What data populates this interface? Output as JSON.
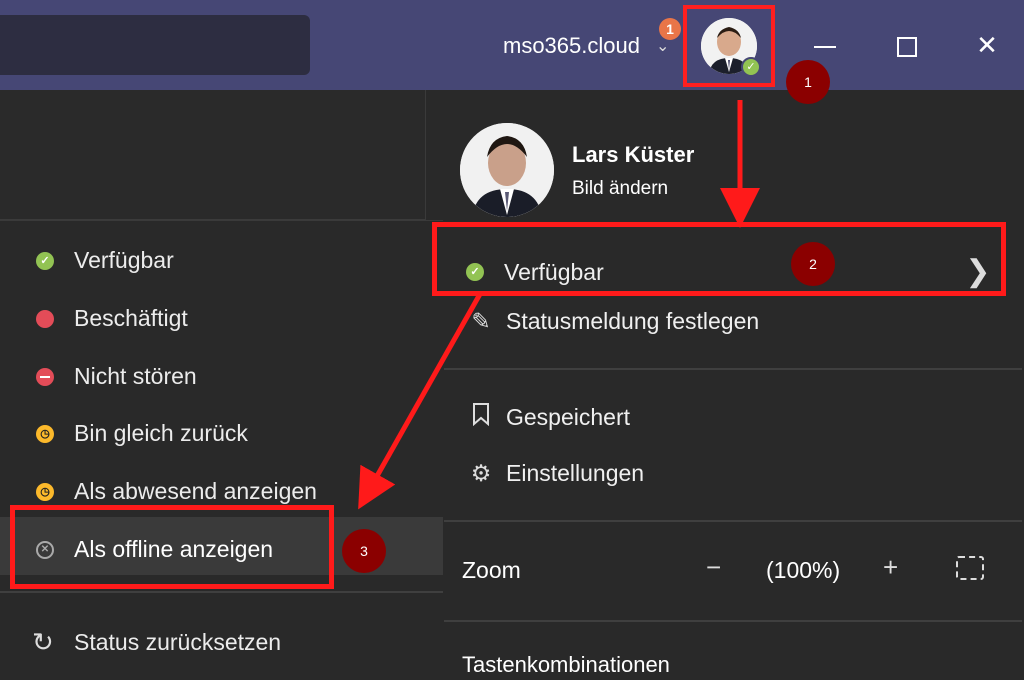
{
  "titlebar": {
    "tenant": "mso365.cloud",
    "notification_count": "1",
    "minimize_icon": "minimize-icon",
    "maximize_icon": "maximize-icon",
    "close_icon": "close-icon",
    "accent": "#464775"
  },
  "profile": {
    "name": "Lars Küster",
    "change_picture": "Bild ändern",
    "status_label": "Verfügbar",
    "status_message": "Statusmeldung festlegen",
    "saved": "Gespeichert",
    "settings": "Einstellungen",
    "zoom_label": "Zoom",
    "zoom_minus": "−",
    "zoom_value": "(100%)",
    "zoom_plus": "+",
    "shortcuts": "Tastenkombinationen"
  },
  "status_menu": {
    "items": [
      {
        "label": "Verfügbar",
        "color": "#92c353"
      },
      {
        "label": "Beschäftigt",
        "color": "#e34c58"
      },
      {
        "label": "Nicht stören",
        "color": "#e34c58"
      },
      {
        "label": "Bin gleich zurück",
        "color": "#fcb92b"
      },
      {
        "label": "Als abwesend anzeigen",
        "color": "#fcb92b"
      },
      {
        "label": "Als offline anzeigen",
        "color": "#aaaaaa"
      }
    ],
    "reset": "Status zurücksetzen"
  },
  "annotations": {
    "step1": "1",
    "step2": "2",
    "step3": "3",
    "highlight_color": "#ff1a1a"
  }
}
